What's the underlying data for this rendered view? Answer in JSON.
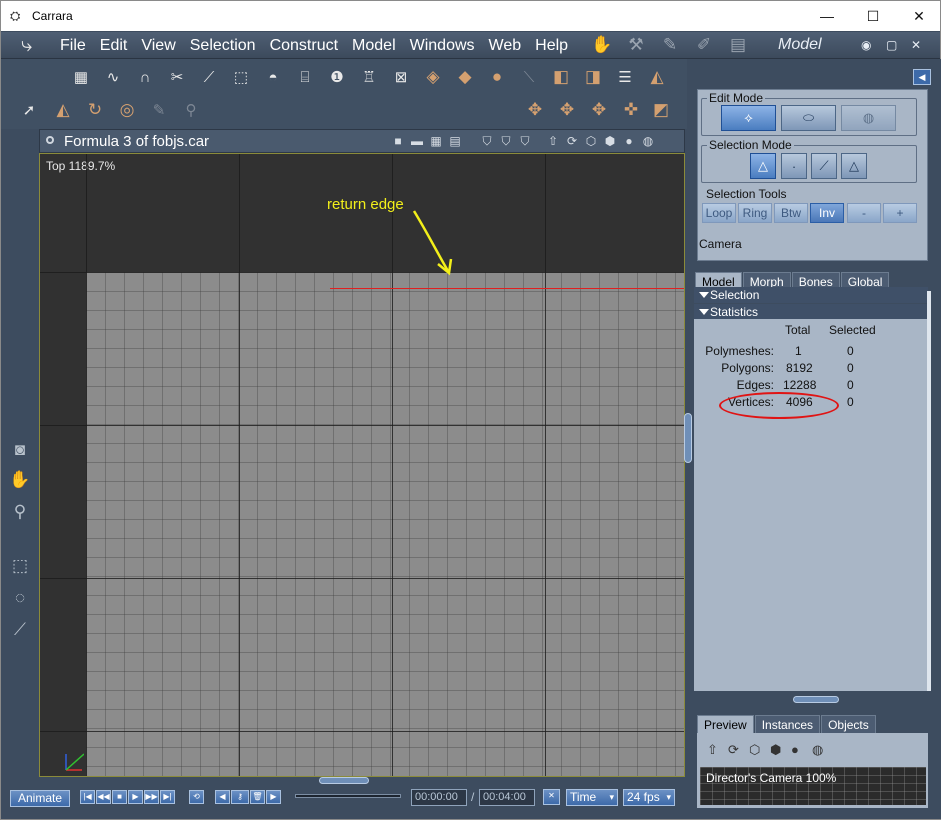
{
  "window": {
    "title": "Carrara",
    "minimize": "—",
    "maximize": "☐",
    "close": "✕"
  },
  "menubar": {
    "items": [
      "File",
      "Edit",
      "View",
      "Selection",
      "Construct",
      "Model",
      "Windows",
      "Web",
      "Help"
    ],
    "room_name": "Model",
    "room_icons": [
      "assemble-room-icon",
      "model-room-icon",
      "storyboard-room-icon",
      "texture-room-icon",
      "render-room-icon"
    ]
  },
  "viewport": {
    "title": "Formula 3 of fobjs.car",
    "view_label": "Top 1189.7%",
    "annotation": "return edge",
    "annotation_color": "#f2ef1a",
    "highlight_color": "#e02020"
  },
  "playbar": {
    "animate_label": "Animate",
    "current_time": "00:00:00",
    "separator": "/",
    "end_time": "00:04:00",
    "time_mode": "Time",
    "fps": "24 fps"
  },
  "panel": {
    "edit_mode_label": "Edit Mode",
    "selection_mode_label": "Selection Mode",
    "selection_tools_label": "Selection Tools",
    "selection_tools": [
      "Loop",
      "Ring",
      "Btw",
      "Inv",
      "-",
      "+"
    ],
    "camera_label": "Camera",
    "tabs": [
      "Model",
      "Morph",
      "Bones",
      "Global"
    ],
    "sections": {
      "selection": "Selection",
      "statistics": "Statistics"
    },
    "stats": {
      "col_total": "Total",
      "col_selected": "Selected",
      "rows": [
        {
          "label": "Polymeshes:",
          "total": "1",
          "selected": "0"
        },
        {
          "label": "Polygons:",
          "total": "8192",
          "selected": "0"
        },
        {
          "label": "Edges:",
          "total": "12288",
          "selected": "0"
        },
        {
          "label": "Vertices:",
          "total": "4096",
          "selected": "0"
        }
      ]
    },
    "preview_tabs": [
      "Preview",
      "Instances",
      "Objects"
    ],
    "preview_caption": "Director's Camera 100%"
  }
}
